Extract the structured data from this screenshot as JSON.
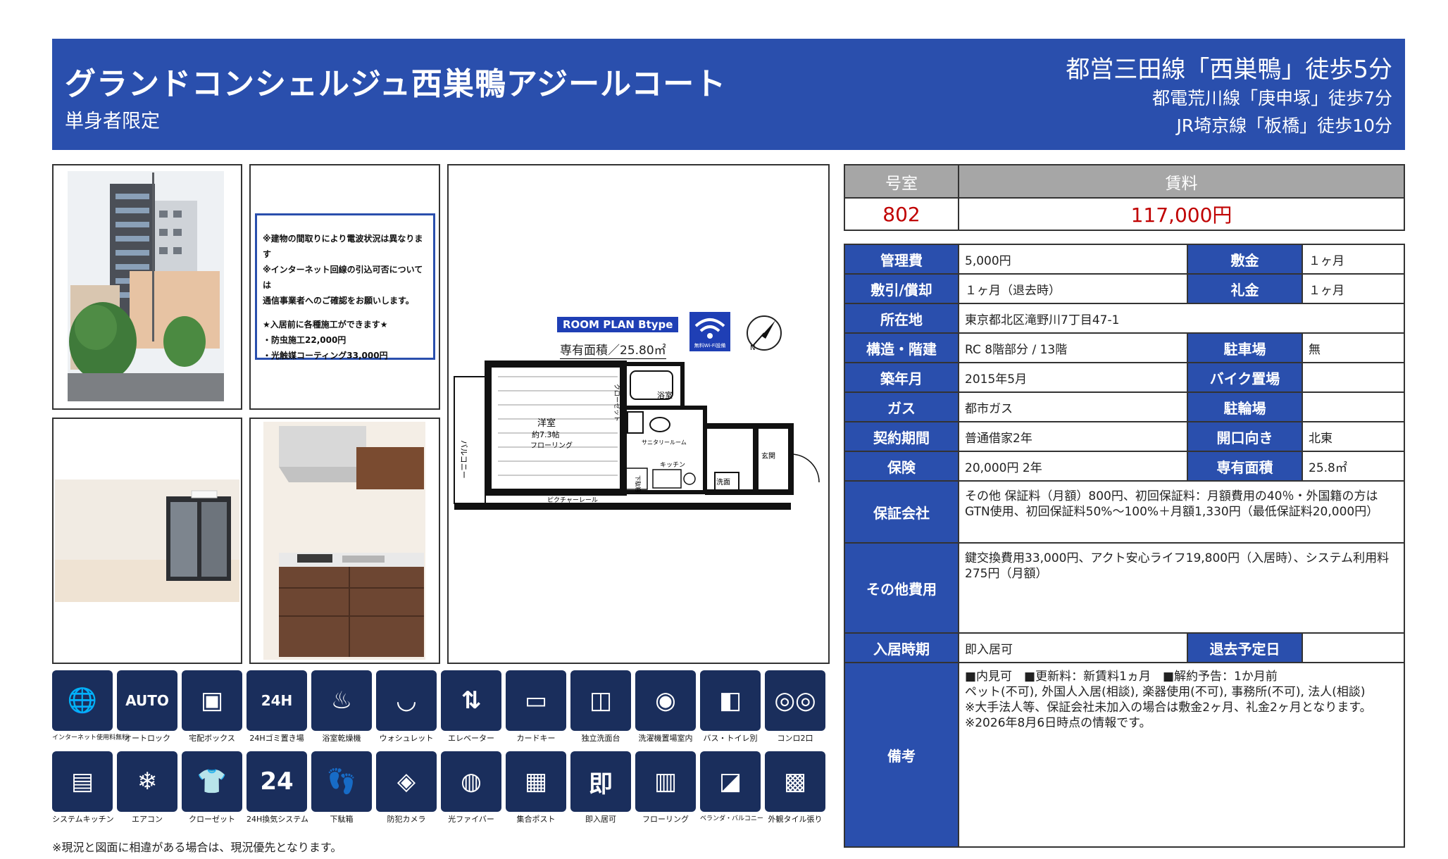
{
  "header": {
    "property_name": "グランドコンシェルジュ西巣鴨アジールコート",
    "subtitle": "単身者限定",
    "access_primary": "都営三田線「西巣鴨」徒歩5分",
    "access_secondary": "都電荒川線「庚申塚」徒歩7分",
    "access_tertiary": "JR埼京線「板橋」徒歩10分"
  },
  "notice": {
    "line1": "※建物の間取りにより電波状況は異なります",
    "line2": "※インターネット回線の引込可否については",
    "line3": "通信事業者へのご確認をお願いします。",
    "line4": "★入居前に各種施工ができます★",
    "line5": "・防虫施工22,000円",
    "line6": "・光触媒コーティング33,000円"
  },
  "floor_plan": {
    "tag": "ROOM PLAN  Btype",
    "area": "専有面積／25.80㎡",
    "wifi_caption": "無料Wi-Fi設備",
    "compass_letter": "N",
    "room_label_1": "洋室",
    "room_label_2": "約7.3帖",
    "room_label_3": "フローリング",
    "balcony": "バルコニー",
    "closet": "クローゼット",
    "bath": "浴室",
    "sanitary": "サニタリールーム",
    "shoebox": "下駄箱",
    "kitchen": "キッチン",
    "washer": "洗面",
    "entrance": "玄関",
    "rail": "ピクチャーレール"
  },
  "equipment": [
    {
      "label": "インターネット使用料無料",
      "icon": "internet-icon",
      "glyph": "🌐"
    },
    {
      "label": "オートロック",
      "icon": "autolock-icon",
      "glyph": "AUTO"
    },
    {
      "label": "宅配ボックス",
      "icon": "delivery-box-icon",
      "glyph": "▣"
    },
    {
      "label": "24Hゴミ置き場",
      "icon": "garbage-icon",
      "glyph": "24H"
    },
    {
      "label": "浴室乾燥機",
      "icon": "bath-dryer-icon",
      "glyph": "♨"
    },
    {
      "label": "ウォシュレット",
      "icon": "washlet-icon",
      "glyph": "◡"
    },
    {
      "label": "エレベーター",
      "icon": "elevator-icon",
      "glyph": "⇅"
    },
    {
      "label": "カードキー",
      "icon": "card-key-icon",
      "glyph": "▭"
    },
    {
      "label": "独立洗面台",
      "icon": "vanity-icon",
      "glyph": "◫"
    },
    {
      "label": "洗濯機置場室内",
      "icon": "washing-machine-icon",
      "glyph": "◉"
    },
    {
      "label": "バス・トイレ別",
      "icon": "bath-toilet-icon",
      "glyph": "◧"
    },
    {
      "label": "コンロ2口",
      "icon": "stove-icon",
      "glyph": "◎◎"
    },
    {
      "label": "システムキッチン",
      "icon": "system-kitchen-icon",
      "glyph": "▤"
    },
    {
      "label": "エアコン",
      "icon": "air-conditioner-icon",
      "glyph": "❄"
    },
    {
      "label": "クローゼット",
      "icon": "closet-icon",
      "glyph": "👕"
    },
    {
      "label": "24H換気システム",
      "icon": "ventilation-icon",
      "glyph": "24"
    },
    {
      "label": "下駄箱",
      "icon": "shoe-box-icon",
      "glyph": "👣"
    },
    {
      "label": "防犯カメラ",
      "icon": "security-camera-icon",
      "glyph": "◈"
    },
    {
      "label": "光ファイバー",
      "icon": "fiber-icon",
      "glyph": "◍"
    },
    {
      "label": "集合ポスト",
      "icon": "mailbox-icon",
      "glyph": "▦"
    },
    {
      "label": "即入居可",
      "icon": "immediate-move-in-icon",
      "glyph": "即"
    },
    {
      "label": "フローリング",
      "icon": "flooring-icon",
      "glyph": "▥"
    },
    {
      "label": "ベランダ・バルコニー",
      "icon": "balcony-icon",
      "glyph": "◪"
    },
    {
      "label": "外観タイル張り",
      "icon": "tile-icon",
      "glyph": "▩"
    }
  ],
  "footnote": "※現況と図面に相違がある場合は、現況優先となります。",
  "rent": {
    "room_header": "号室",
    "rent_header": "賃料",
    "room_no": "802",
    "rent_value": "117,000円"
  },
  "info": {
    "mgmt_fee_label": "管理費",
    "mgmt_fee": "5,000円",
    "deposit_label": "敷金",
    "deposit": "１ヶ月",
    "shikibiki_label": "敷引/償却",
    "shikibiki": "１ヶ月（退去時）",
    "key_money_label": "礼金",
    "key_money": "１ヶ月",
    "address_label": "所在地",
    "address": "東京都北区滝野川7丁目47-1",
    "structure_label": "構造・階建",
    "structure": "RC 8階部分 / 13階",
    "parking_label": "駐車場",
    "parking": "無",
    "built_label": "築年月",
    "built": "2015年5月",
    "bike_label": "バイク置場",
    "bike": "",
    "gas_label": "ガス",
    "gas": "都市ガス",
    "bicycle_label": "駐輪場",
    "bicycle": "",
    "contract_label": "契約期間",
    "contract": "普通借家2年",
    "aspect_label": "開口向き",
    "aspect": "北東",
    "insurance_label": "保険",
    "insurance": "20,000円 2年",
    "area_label": "専有面積",
    "area": "25.8㎡",
    "guarantor_label": "保証会社",
    "guarantor": "その他 保証料（月額）800円、初回保証料：月額費用の40％・外国籍の方はGTN使用、初回保証料50%～100%＋月額1,330円（最低保証料20,000円）",
    "other_fees_label": "その他費用",
    "other_fees": "鍵交換費用33,000円、アクト安心ライフ19,800円（入居時）、システム利用料275円（月額）",
    "move_in_label": "入居時期",
    "move_in": "即入居可",
    "move_out_label": "退去予定日",
    "move_out": "",
    "remarks_label": "備考",
    "remarks_1": "■内見可　■更新料：新賃料1ヵ月　■解約予告：1か月前",
    "remarks_2": "ペット(不可), 外国人入居(相談), 楽器使用(不可), 事務所(不可), 法人(相談)",
    "remarks_3": "※大手法人等、保証会社未加入の場合は敷金2ヶ月、礼金2ヶ月となります。",
    "remarks_4": "※2026年8月6日時点の情報です。"
  },
  "colors": {
    "header_blue": "#2a4fad",
    "label_blue": "#2a4fad",
    "icon_navy": "#1a2e5c",
    "rent_red": "#c00000",
    "grey_header": "#a6a6a6"
  }
}
